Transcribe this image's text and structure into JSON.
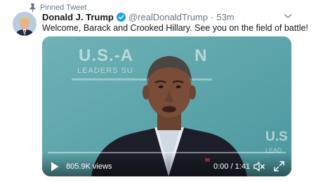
{
  "pinned_label": "Pinned Tweet",
  "author": {
    "display_name": "Donald J. Trump",
    "handle": "@realDonaldTrump",
    "separator": "·",
    "timestamp": "53m",
    "verified": true
  },
  "tweet_text": "Welcome, Barack and Crooked Hillary. See you on the field of battle!",
  "video": {
    "background_title": "U.S.-A",
    "background_title_right": "N",
    "background_subtitle": "LEADERS SU",
    "background_right": "U.S",
    "background_right_sub": "LEAD",
    "view_count": "805.9K views",
    "time": "0:00 / 1:41",
    "progress": 0.0
  },
  "icons": {
    "pin": "pin-icon",
    "verified": "verified-badge-icon",
    "chevron": "chevron-down-icon",
    "play": "play-icon",
    "mute": "volume-muted-icon",
    "fullscreen": "fullscreen-icon"
  },
  "colors": {
    "verified_blue": "#1da1f2",
    "secondary_text": "#657786",
    "primary_text": "#14171a",
    "video_background": "#5da6ac"
  }
}
